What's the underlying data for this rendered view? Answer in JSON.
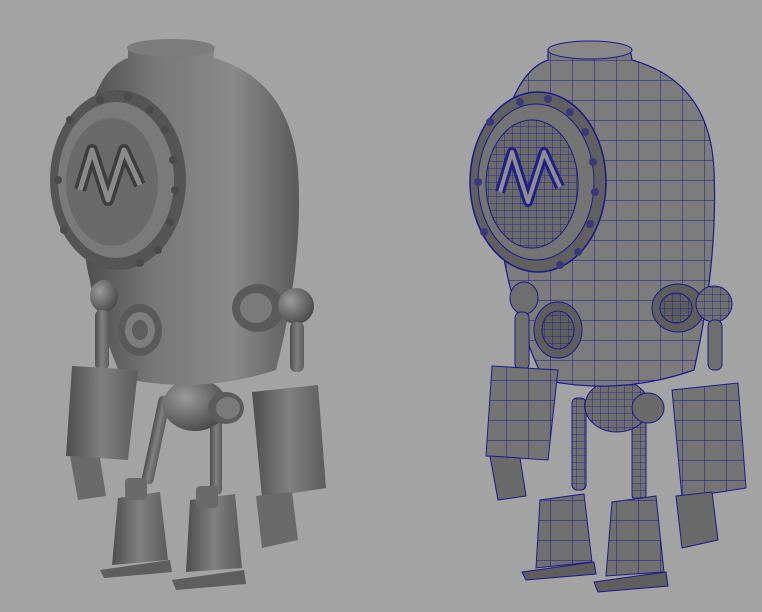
{
  "scene": {
    "background_color": "#a3a3a3",
    "models": [
      {
        "name": "shaded-robot",
        "display_mode": "smooth-shaded",
        "base_color": "#6e6e6e"
      },
      {
        "name": "wireframe-robot",
        "display_mode": "wireframe-on-shaded",
        "base_color": "#767676",
        "wire_color": "#1a1a8c"
      }
    ]
  }
}
